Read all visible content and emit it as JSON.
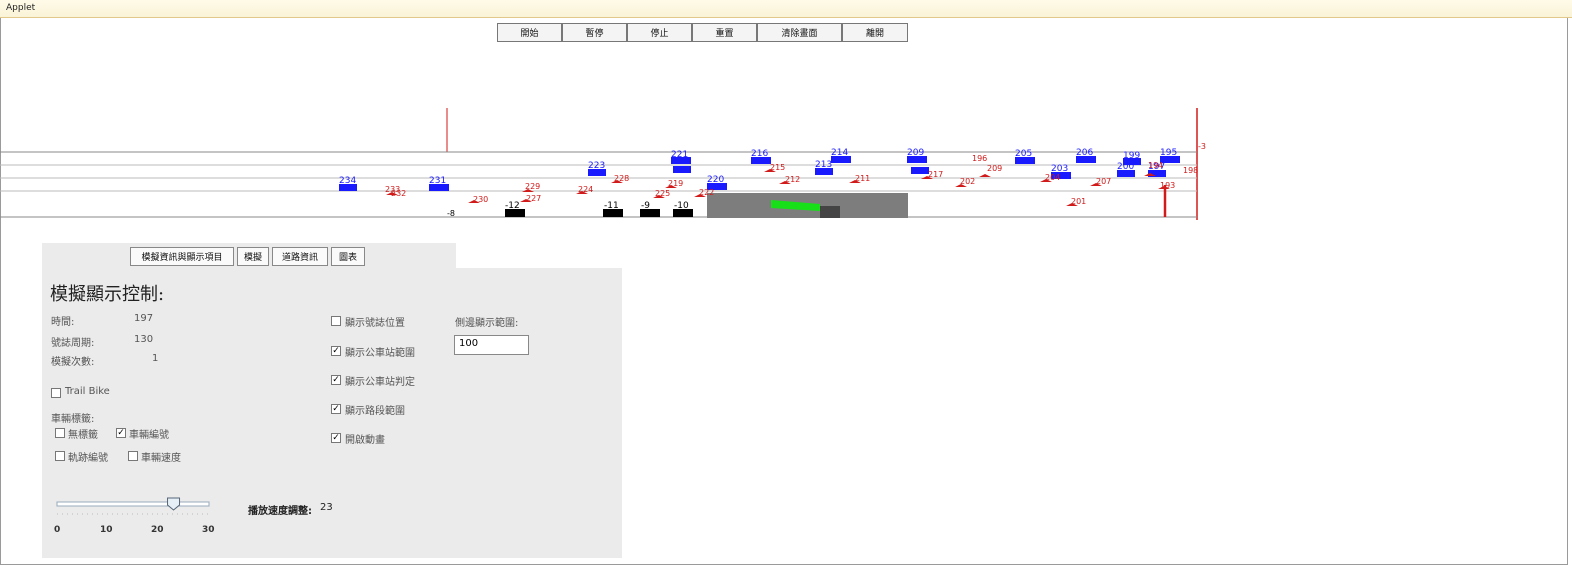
{
  "window": {
    "title": "Applet"
  },
  "toolbar": {
    "buttons": [
      "開始",
      "暫停",
      "停止",
      "重置",
      "清除畫面",
      "離開"
    ]
  },
  "road": {
    "cars_blue": [
      "234",
      "231",
      "223",
      "221",
      "220",
      "216",
      "214",
      "213",
      "209",
      "206",
      "205",
      "203",
      "200",
      "199",
      "197",
      "195"
    ],
    "cars_red": [
      "233",
      "232",
      "230",
      "229",
      "227",
      "224",
      "228",
      "225",
      "219",
      "222",
      "215",
      "212",
      "211",
      "217",
      "202",
      "209",
      "204",
      "207",
      "201",
      "196",
      "194",
      "198",
      "193"
    ],
    "signals_black": [
      "-8",
      "-12",
      "-11",
      "-9",
      "-10"
    ],
    "marker_right": "-3",
    "colors": {
      "bus": "#1a1aff",
      "car": "#d11a1a",
      "signal": "#000000",
      "station": "#7d7d7d",
      "green": "#18e018",
      "lines": "#8a8a8a"
    }
  },
  "tabs": [
    "模擬資訊與顯示項目",
    "模擬",
    "道路資訊",
    "圖表"
  ],
  "panel": {
    "heading": "模擬顯示控制:",
    "time_label": "時間:",
    "time_value": "197",
    "cycle_label": "號誌周期:",
    "cycle_value": "130",
    "runs_label": "模擬次數:",
    "runs_value": "1",
    "trail_label": "Trail Bike",
    "vehicle_label_title": "車輛標籤:",
    "opt_none": "無標籤",
    "opt_vehicle_id": "車輛編號",
    "opt_track_id": "軌跡編號",
    "opt_speed": "車輛速度",
    "show_signal_pos": "顯示號誌位置",
    "show_bus_range": "顯示公車站範圍",
    "show_bus_judge": "顯示公車站判定",
    "show_road_range": "顯示路段範圍",
    "animation": "開啟動畫",
    "side_range_label": "側邊顯示範圍:",
    "side_range_value": "100",
    "speed_label": "播放速度調整:",
    "speed_value": "23",
    "slider_ticks": [
      "0",
      "10",
      "20",
      "30"
    ]
  }
}
